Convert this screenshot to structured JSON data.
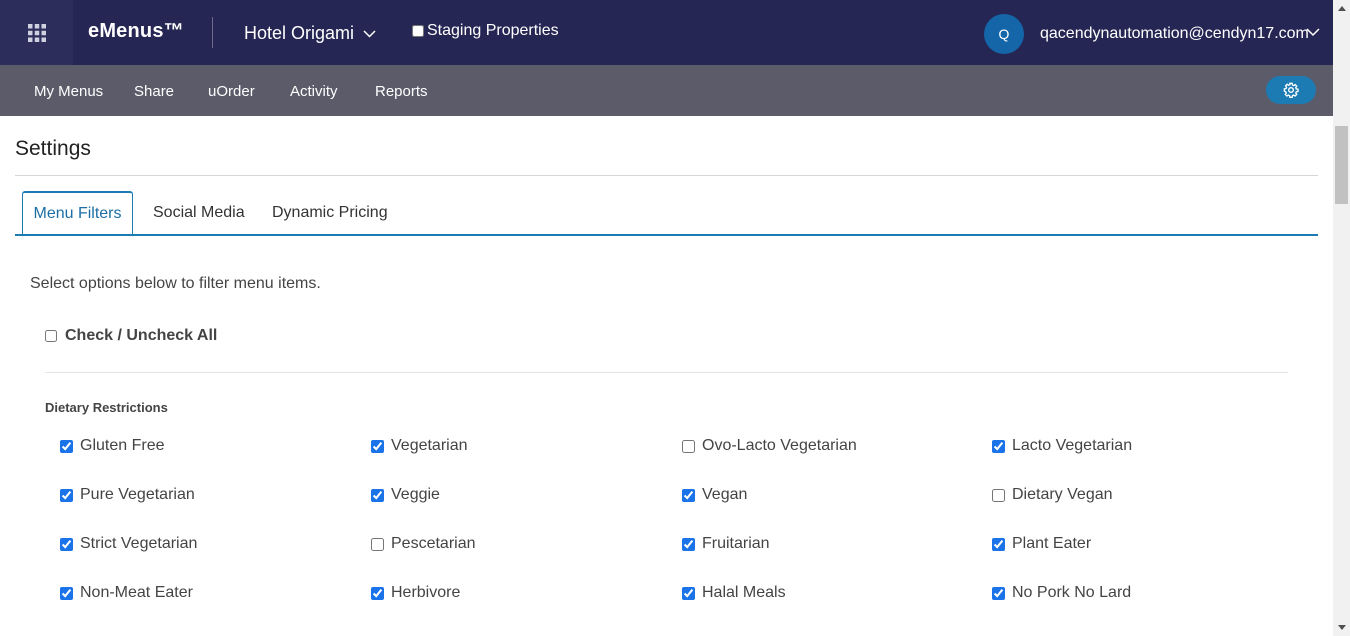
{
  "header": {
    "brand": "eMenus™",
    "hotel": "Hotel Origami",
    "staging_label": "Staging Properties",
    "staging_checked": false,
    "avatar_initial": "Q",
    "user_email": "qacendynautomation@cendyn17.com"
  },
  "nav": {
    "items": [
      "My Menus",
      "Share",
      "uOrder",
      "Activity",
      "Reports"
    ]
  },
  "page": {
    "title": "Settings",
    "tabs": [
      "Menu Filters",
      "Social Media",
      "Dynamic Pricing"
    ],
    "active_tab": "Menu Filters",
    "intro": "Select options below to filter menu items.",
    "check_all_label": "Check / Uncheck All",
    "check_all_checked": false,
    "section_title": "Dietary Restrictions",
    "options": [
      {
        "label": "Gluten Free",
        "checked": true
      },
      {
        "label": "Vegetarian",
        "checked": true
      },
      {
        "label": "Ovo-Lacto Vegetarian",
        "checked": false
      },
      {
        "label": "Lacto Vegetarian",
        "checked": true
      },
      {
        "label": "Pure Vegetarian",
        "checked": true
      },
      {
        "label": "Veggie",
        "checked": true
      },
      {
        "label": "Vegan",
        "checked": true
      },
      {
        "label": "Dietary Vegan",
        "checked": false
      },
      {
        "label": "Strict Vegetarian",
        "checked": true
      },
      {
        "label": "Pescetarian",
        "checked": false
      },
      {
        "label": "Fruitarian",
        "checked": true
      },
      {
        "label": "Plant Eater",
        "checked": true
      },
      {
        "label": "Non-Meat Eater",
        "checked": true
      },
      {
        "label": "Herbivore",
        "checked": true
      },
      {
        "label": "Halal Meals",
        "checked": true
      },
      {
        "label": "No Pork No Lard",
        "checked": true
      }
    ]
  },
  "colors": {
    "topbar": "#262654",
    "navbar": "#5c5b6a",
    "accent": "#1c7bb3"
  }
}
